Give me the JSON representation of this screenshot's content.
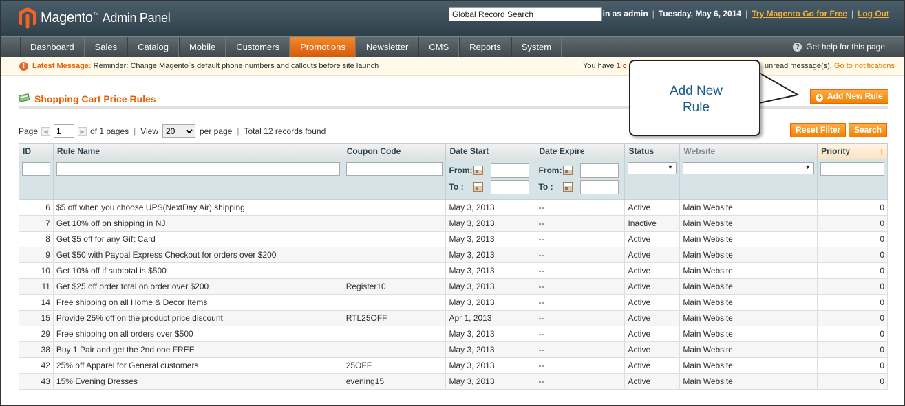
{
  "header": {
    "logo_text": "Magento",
    "logo_tm": "™",
    "logo_sub": "Admin Panel",
    "search_value": "Global Record Search",
    "logged_in": "Logged in as admin",
    "date": "Tuesday, May 6, 2014",
    "try_link": "Try Magento Go for Free",
    "logout": "Log Out",
    "separator": "|"
  },
  "nav": {
    "items": [
      "Dashboard",
      "Sales",
      "Catalog",
      "Mobile",
      "Customers",
      "Promotions",
      "Newsletter",
      "CMS",
      "Reports",
      "System"
    ],
    "active": "Promotions",
    "help": "Get help for this page"
  },
  "message": {
    "icon": "!",
    "label": "Latest Message:",
    "text": " Reminder: Change Magento`s default phone numbers and callouts before site launch",
    "right_prefix": "You have",
    "right_count": "1 c",
    "right_suffix": "unread message(s).",
    "link": "Go to notifications"
  },
  "page": {
    "title": "Shopping Cart Price Rules",
    "add_button": "Add New Rule",
    "reset_button": "Reset Filter",
    "search_button": "Search"
  },
  "pager": {
    "page_label": "Page",
    "page_value": "1",
    "of_pages": "of 1 pages",
    "view_label": "View",
    "view_value": "20",
    "per_page": "per page",
    "total": "Total 12 records found",
    "separator": "|"
  },
  "grid": {
    "columns": [
      "ID",
      "Rule Name",
      "Coupon Code",
      "Date Start",
      "Date Expire",
      "Status",
      "Website",
      "Priority"
    ],
    "sort_arrow": "↑",
    "from_label": "From:",
    "to_label": "To :",
    "rows": [
      {
        "id": "6",
        "name": "$5 off when you choose UPS(NextDay Air) shipping",
        "coupon": "",
        "start": "May 3, 2013",
        "expire": "--",
        "status": "Active",
        "website": "Main Website",
        "priority": "0"
      },
      {
        "id": "7",
        "name": "Get 10% off on shipping in NJ",
        "coupon": "",
        "start": "May 3, 2013",
        "expire": "--",
        "status": "Inactive",
        "website": "Main Website",
        "priority": "0"
      },
      {
        "id": "8",
        "name": "Get $5 off for any Gift Card",
        "coupon": "",
        "start": "May 3, 2013",
        "expire": "--",
        "status": "Active",
        "website": "Main Website",
        "priority": "0"
      },
      {
        "id": "9",
        "name": "Get $50 with Paypal Express Checkout for orders over $200",
        "coupon": "",
        "start": "May 3, 2013",
        "expire": "--",
        "status": "Active",
        "website": "Main Website",
        "priority": "0"
      },
      {
        "id": "10",
        "name": "Get 10% off if subtotal is $500",
        "coupon": "",
        "start": "May 3, 2013",
        "expire": "--",
        "status": "Active",
        "website": "Main Website",
        "priority": "0"
      },
      {
        "id": "11",
        "name": "Get $25 off order total on order over $200",
        "coupon": "Register10",
        "start": "May 3, 2013",
        "expire": "--",
        "status": "Active",
        "website": "Main Website",
        "priority": "0"
      },
      {
        "id": "14",
        "name": "Free shipping on all Home & Decor Items",
        "coupon": "",
        "start": "May 3, 2013",
        "expire": "--",
        "status": "Active",
        "website": "Main Website",
        "priority": "0"
      },
      {
        "id": "15",
        "name": "Provide 25% off on the product price discount",
        "coupon": "RTL25OFF",
        "start": "Apr 1, 2013",
        "expire": "--",
        "status": "Active",
        "website": "Main Website",
        "priority": "0"
      },
      {
        "id": "29",
        "name": "Free shipping on all orders over $500",
        "coupon": "",
        "start": "May 3, 2013",
        "expire": "--",
        "status": "Active",
        "website": "Main Website",
        "priority": "0"
      },
      {
        "id": "38",
        "name": "Buy 1 Pair and get the 2nd one FREE",
        "coupon": "",
        "start": "May 3, 2013",
        "expire": "--",
        "status": "Active",
        "website": "Main Website",
        "priority": "0"
      },
      {
        "id": "42",
        "name": "25% off Apparel for General customers",
        "coupon": "25OFF",
        "start": "May 3, 2013",
        "expire": "--",
        "status": "Active",
        "website": "Main Website",
        "priority": "0"
      },
      {
        "id": "43",
        "name": "15% Evening Dresses",
        "coupon": "evening15",
        "start": "May 3, 2013",
        "expire": "--",
        "status": "Active",
        "website": "Main Website",
        "priority": "0"
      }
    ]
  },
  "callout": {
    "line1": "Add New",
    "line2": "Rule"
  },
  "colors": {
    "accent": "#eb5e00",
    "header_bg": "#2e3f49",
    "callout_text": "#1f5b86"
  }
}
